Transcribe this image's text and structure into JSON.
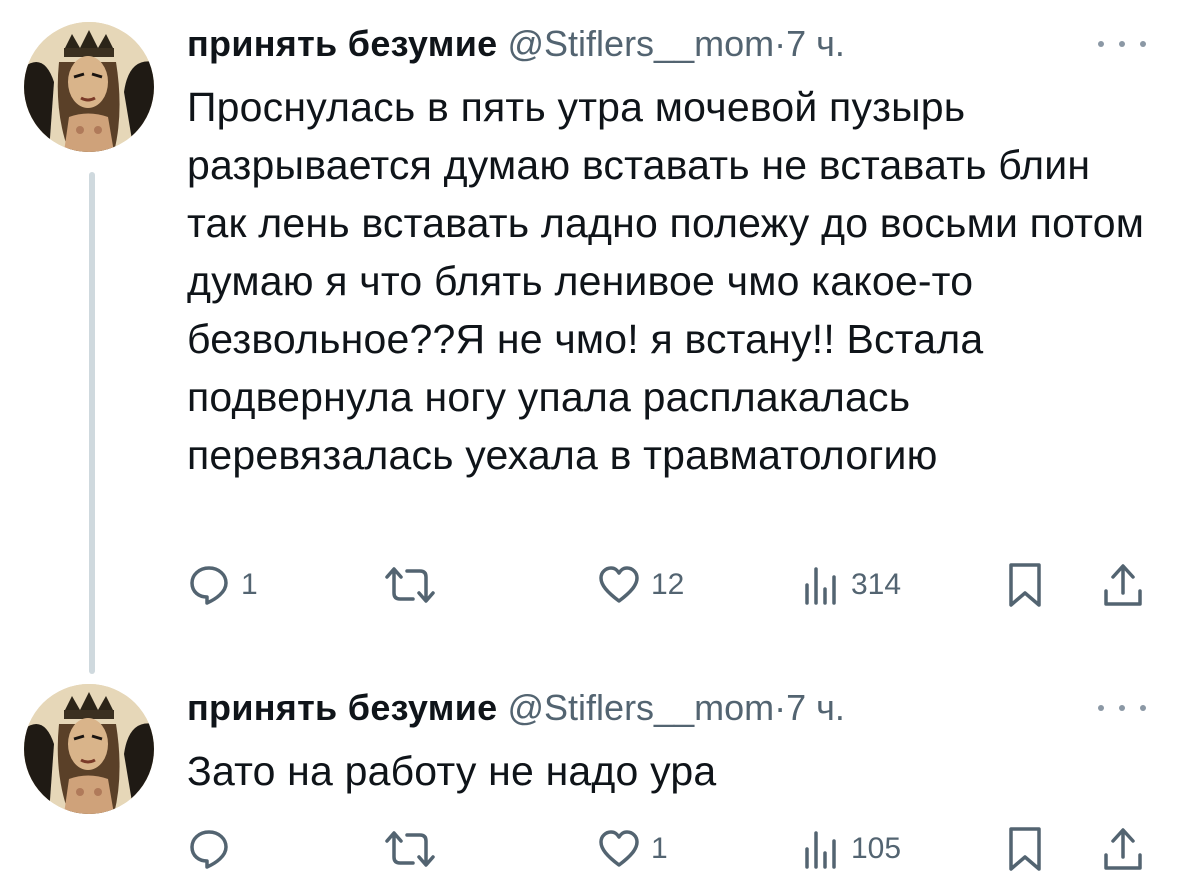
{
  "tweets": [
    {
      "author": {
        "name": "принять безумие",
        "handle": "@Stiflers__mom",
        "separator": "·",
        "time": "7 ч."
      },
      "text": "Проснулась в пять утра мочевой пузырь разрывается думаю вставать не вставать блин так лень вставать ладно полежу до восьми потом думаю я что блять ленивое чмо какое-то безвольное??Я не чмо! я встану!! Встала подвернула ногу упала расплакалась перевязалась уехала в травматологию",
      "stats": {
        "replies": "1",
        "retweets": "",
        "likes": "12",
        "views": "314"
      }
    },
    {
      "author": {
        "name": "принять безумие",
        "handle": "@Stiflers__mom",
        "separator": "·",
        "time": "7 ч."
      },
      "text": "Зато на работу не надо ура",
      "stats": {
        "replies": "",
        "retweets": "",
        "likes": "1",
        "views": "105"
      }
    }
  ],
  "icons": {
    "reply": "speech-bubble-icon",
    "retweet": "retweet-arrows-icon",
    "like": "heart-icon",
    "views": "bar-chart-icon",
    "bookmark": "bookmark-icon",
    "share": "share-upload-icon",
    "more": "more-dots-icon"
  },
  "colors": {
    "text": "#0f1419",
    "secondary": "#536471",
    "thread_line": "#cfd9de"
  }
}
